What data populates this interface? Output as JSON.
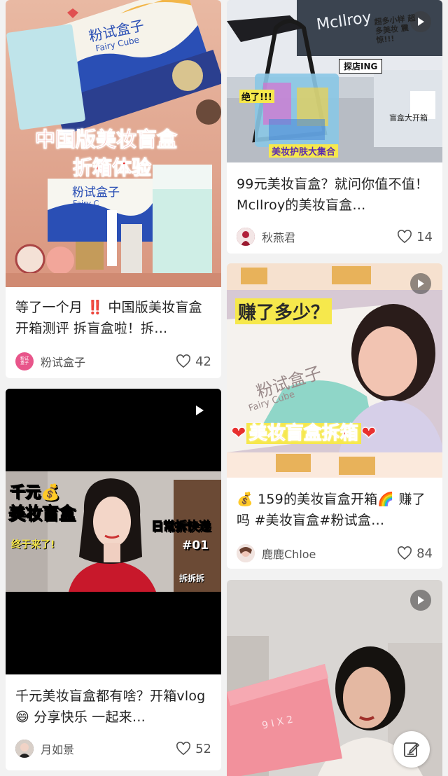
{
  "cards": [
    {
      "title": "等了一个月 ‼️ 中国版美妆盲盒开箱测评 拆盲盒啦！拆…",
      "author": "粉试盒子",
      "avatar_text": "粉试盒子",
      "likes": "42",
      "thumb_text": {
        "line1": "中国版美妆盲盒",
        "line2": "折箱体验",
        "box_brand": "粉试盒子",
        "box_sub": "Fairy Cube",
        "box_brand2": "粉试盒子",
        "box_sub2": "Fairy C"
      }
    },
    {
      "title": "99元美妆盲盒？就问你值不值！ McIlroy的美妆盲盒…",
      "author": "秋燕君",
      "likes": "14",
      "thumb_text": {
        "store": "McIlroy",
        "note": "超多小样 超多美妆 震惊!!!",
        "tag": "探店ING",
        "wow": "绝了!!!",
        "bottom": "美妆护肤大集合",
        "corner": "盲盒大开箱"
      }
    },
    {
      "title": "💰 159的美妆盲盒开箱🌈 赚了吗 #美妆盲盒#粉试盒…",
      "author": "鹿鹿Chloe",
      "likes": "84",
      "thumb_text": {
        "q": "赚了多少？",
        "banner": "美妆盲盒拆箱",
        "box_brand": "粉试盒子",
        "box_sub": "Fairy Cube"
      }
    },
    {
      "title": "千元美妆盲盒都有啥？开箱vlog 😄 分享快乐 一起来…",
      "author": "月如景",
      "likes": "52",
      "thumb_text": {
        "l1": "千元💰",
        "l2": "美妆盲盒",
        "l3": "终于来了!",
        "r1": "日常拆快递",
        "r2": "#01",
        "r3": "拆拆拆"
      }
    },
    {
      "thumb_text": {
        "box_text": "9 I X 2"
      }
    }
  ],
  "colors": {
    "accent_red": "#e8302f",
    "like_gray": "#555555",
    "bg": "#f2f2f2"
  }
}
